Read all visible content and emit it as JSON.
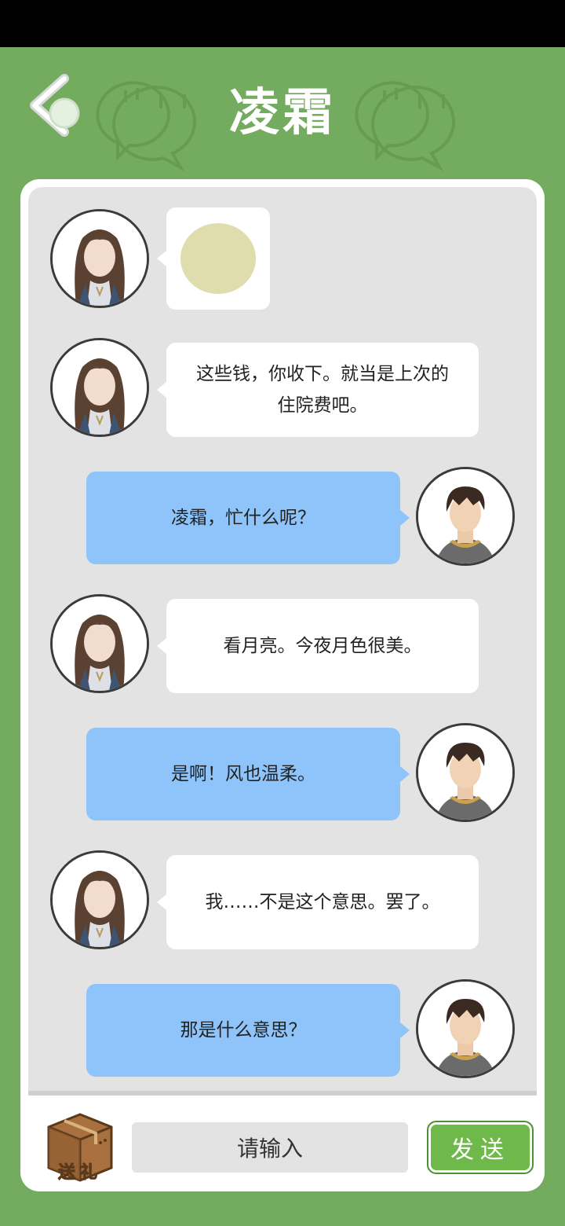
{
  "header": {
    "title": "凌霜",
    "back_icon": "back-arrow-icon"
  },
  "colors": {
    "background": "#73ab5f",
    "bubble_self": "#8ec4fa",
    "bubble_other": "#ffffff",
    "send_button": "#6fb94a"
  },
  "messages": [
    {
      "sender": "凌霜",
      "side": "left",
      "type": "image",
      "content": "moon-image"
    },
    {
      "sender": "凌霜",
      "side": "left",
      "type": "text",
      "line1": "这些钱，你收下。就当是上次的",
      "line2": "住院费吧。"
    },
    {
      "sender": "me",
      "side": "right",
      "type": "text",
      "text": "凌霜，忙什么呢？"
    },
    {
      "sender": "凌霜",
      "side": "left",
      "type": "text",
      "text": "看月亮。今夜月色很美。"
    },
    {
      "sender": "me",
      "side": "right",
      "type": "text",
      "text": "是啊！风也温柔。"
    },
    {
      "sender": "凌霜",
      "side": "left",
      "type": "text",
      "text": "我……不是这个意思。罢了。"
    },
    {
      "sender": "me",
      "side": "right",
      "type": "text",
      "text": "那是什么意思？"
    }
  ],
  "footer": {
    "gift_label": "送礼",
    "gift_icon": "gift-box-icon",
    "input_placeholder": "请输入",
    "send_label": "发送"
  }
}
